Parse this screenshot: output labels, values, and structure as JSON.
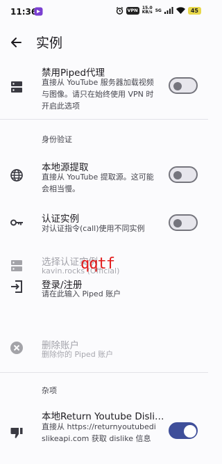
{
  "status_bar": {
    "time": "11:36",
    "vpn": "VPN",
    "net_speed_value": "15.0",
    "net_speed_unit": "KB/s",
    "signal": "5G",
    "battery": "45"
  },
  "app_bar": {
    "title": "实例"
  },
  "settings": {
    "disable_proxy": {
      "title": "禁用Piped代理",
      "subtitle": "直接从 YouTube 服务器加载视频与图像。请只在始终使用 VPN 时开启此选项",
      "enabled": false
    },
    "auth_section_header": "身份验证",
    "local_extraction": {
      "title": "本地源提取",
      "subtitle": "直接从 YouTube 提取源。这可能会相当慢。",
      "enabled": false
    },
    "auth_instance": {
      "title": "认证实例",
      "subtitle": "对认证指令(call)使用不同实例",
      "enabled": false
    },
    "select_auth_instance": {
      "title": "选择认证实例",
      "subtitle": "kavin.rocks (Official)"
    },
    "login_register": {
      "title": "登录/注册",
      "subtitle": "请在此输入 Piped 账户"
    },
    "delete_account": {
      "title": "删除账户",
      "subtitle": "删除你的 Piped 账户"
    },
    "misc_section_header": "杂项",
    "return_dislike": {
      "title": "本地Return Youtube Disli…",
      "subtitle": "直接从 https://returnyoutubedislikeapi.com 获取 dislike 信息",
      "enabled": true
    }
  },
  "watermark": "qqtf"
}
